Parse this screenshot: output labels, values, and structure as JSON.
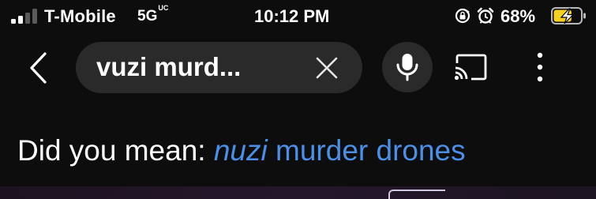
{
  "status_bar": {
    "carrier": "T-Mobile",
    "network": "5G",
    "network_badge": "UC",
    "time": "10:12 PM",
    "battery_percent": "68%",
    "battery_level": 0.68,
    "battery_charging": true,
    "battery_color": "#f5d020",
    "signal_bars_active": 2,
    "signal_bars_total": 4,
    "icons": [
      "orientation-lock-icon",
      "alarm-icon",
      "battery-charging-icon"
    ]
  },
  "toolbar": {
    "back_icon": "chevron-left-icon",
    "search_query": "vuzi murd...",
    "clear_icon": "close-icon",
    "voice_icon": "microphone-icon",
    "cast_icon": "cast-icon",
    "menu_icon": "more-vertical-icon"
  },
  "suggestion": {
    "prefix": "Did you mean:",
    "corrected_word": "nuzi",
    "rest": "murder drones",
    "link_color": "#4a90e8"
  }
}
